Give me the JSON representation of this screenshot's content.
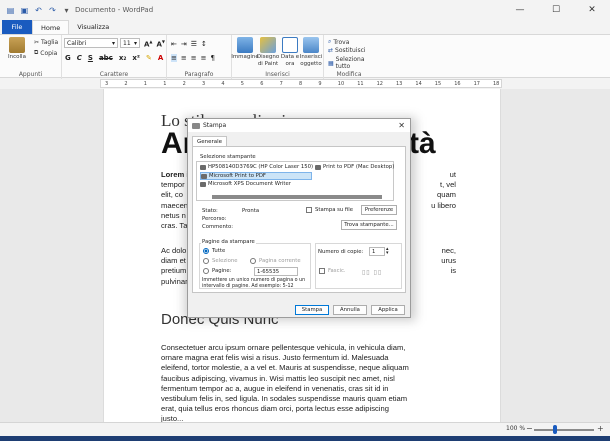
{
  "window": {
    "title": "Documento - WordPad",
    "controls": [
      "—",
      "☐",
      "✕"
    ]
  },
  "tabs": [
    {
      "label": "File"
    },
    {
      "label": "Home"
    },
    {
      "label": "Visualizza"
    }
  ],
  "ribbon": {
    "clipboard": {
      "paste": "Incolla",
      "cut": "Taglia",
      "copy": "Copia",
      "group": "Appunti"
    },
    "font": {
      "family": "Calibri",
      "size": "11",
      "group": "Carattere"
    },
    "paragraph": {
      "group": "Paragrafo"
    },
    "insert": {
      "image": "Immagine",
      "paint": "Disegno di Paint",
      "datetime": "Data e ora",
      "object": "Inserisci oggetto",
      "group": "Inserisci"
    },
    "edit": {
      "find": "Trova",
      "replace": "Sostituisci",
      "selectall": "Seleziona tutto",
      "group": "Modifica"
    }
  },
  "ruler": [
    "3",
    "2",
    "1",
    "1",
    "2",
    "3",
    "4",
    "5",
    "6",
    "7",
    "8",
    "9",
    "10",
    "11",
    "12",
    "13",
    "14",
    "15",
    "16",
    "17",
    "18"
  ],
  "document": {
    "line1": "Lo stile semplice in casa",
    "title_left": "Ar",
    "title_right": "tà",
    "p1": [
      "Lorem i",
      "tempor",
      "elit, co",
      "maecen",
      "netus n",
      "cras. Ta"
    ],
    "p1_right": [
      "ut",
      "t, vel",
      "quam",
      "u libero",
      ""
    ],
    "p2": [
      "Ac dolo",
      "diam et",
      "pretium",
      "pulvinar"
    ],
    "p2_right": [
      "nec,",
      "urus",
      "is",
      ""
    ],
    "subheading": "Donec Quis Nunc",
    "p3": [
      "Consectetuer arcu ipsum ornare pellentesque vehicula, in vehicula diam,",
      "ornare magna erat felis wisi a risus. Justo fermentum id. Malesuada",
      "eleifend, tortor molestie, a a vel et. Mauris at suspendisse, neque aliquam",
      "faucibus adipiscing, vivamus in. Wisi mattis leo suscipit nec amet, nisl",
      "fermentum tempor ac a, augue in eleifend in venenatis, cras sit id in",
      "vestibulum felis in, sed ligula. In sodales suspendisse mauris quam etiam",
      "erat, quia tellus eros rhoncus diam orci, porta lectus esse adipiscing",
      "justo..."
    ]
  },
  "status": {
    "zoom": "100 %",
    "zoom_fraction": 0.35
  },
  "dialog": {
    "title": "Stampa",
    "tab": "Generale",
    "select_printer_label": "Selezione stampante",
    "printers": [
      "HP508140D3769C (HP Color Laser 150)",
      "Print to PDF (Mac Desktop)",
      "Microsoft Print to PDF",
      "Microsoft XPS Document Writer"
    ],
    "status_label": "Stato:",
    "status_value": "Pronta",
    "location_label": "Percorso:",
    "comment_label": "Commento:",
    "print_to_file": "Stampa su file",
    "preferences": "Preferenze",
    "find_printer": "Trova stampante...",
    "page_range_label": "Pagine da stampare",
    "all": "Tutte",
    "selection": "Selezione",
    "current_page": "Pagina corrente",
    "pages": "Pagine:",
    "pages_value": "1-65535",
    "hint_line1": "Immettere un unico numero di pagina o un",
    "hint_line2": "intervallo di pagine. Ad esempio: 5-12",
    "copies_label": "Numero di copie:",
    "copies_value": "1",
    "collate": "Fascic.",
    "btn_print": "Stampa",
    "btn_cancel": "Annulla",
    "btn_apply": "Applica"
  }
}
